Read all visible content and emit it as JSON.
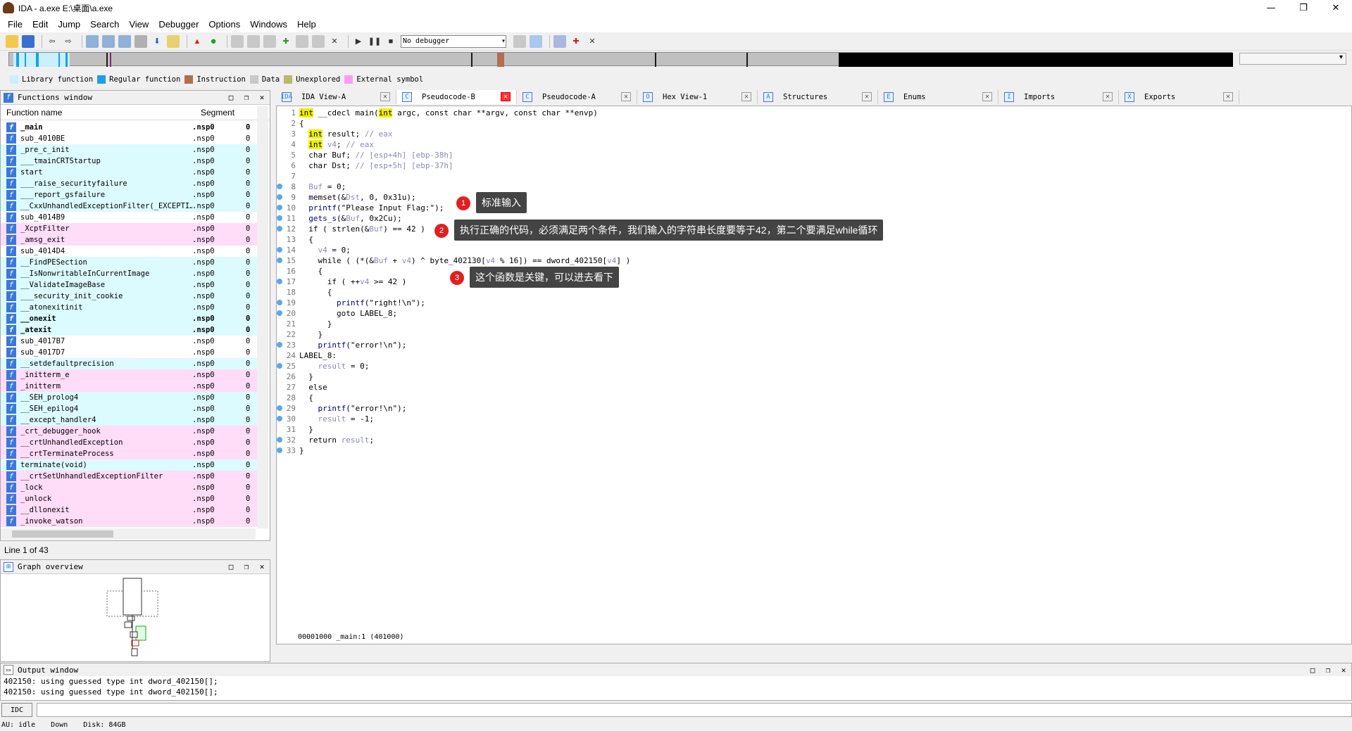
{
  "window": {
    "title": "IDA - a.exe E:\\桌面\\a.exe",
    "min": "—",
    "max": "❐",
    "close": "✕"
  },
  "menu": [
    "File",
    "Edit",
    "Jump",
    "Search",
    "View",
    "Debugger",
    "Options",
    "Windows",
    "Help"
  ],
  "toolbar": {
    "debugger_select": "No debugger"
  },
  "legend": [
    {
      "label": "Library function",
      "color": "#c8f0ff"
    },
    {
      "label": "Regular function",
      "color": "#1aa0e6"
    },
    {
      "label": "Instruction",
      "color": "#b07050"
    },
    {
      "label": "Data",
      "color": "#c8c8c8"
    },
    {
      "label": "Unexplored",
      "color": "#b8b870"
    },
    {
      "label": "External symbol",
      "color": "#ff9cf0"
    }
  ],
  "functions_window": {
    "title": "Functions window",
    "col_name": "Function name",
    "col_segment": "Segment",
    "col_s": "S",
    "line_info": "Line 1 of 43",
    "rows": [
      {
        "name": "_main",
        "seg": ".nsp0",
        "s": "0",
        "c": "white",
        "b": true
      },
      {
        "name": "sub_4010BE",
        "seg": ".nsp0",
        "s": "0",
        "c": "white",
        "b": false
      },
      {
        "name": "_pre_c_init",
        "seg": ".nsp0",
        "s": "0",
        "c": "cyan",
        "b": false
      },
      {
        "name": "___tmainCRTStartup",
        "seg": ".nsp0",
        "s": "0",
        "c": "cyan",
        "b": false
      },
      {
        "name": "start",
        "seg": ".nsp0",
        "s": "0",
        "c": "cyan",
        "b": false
      },
      {
        "name": "___raise_securityfailure",
        "seg": ".nsp0",
        "s": "0",
        "c": "cyan",
        "b": false
      },
      {
        "name": "___report_gsfailure",
        "seg": ".nsp0",
        "s": "0",
        "c": "cyan",
        "b": false
      },
      {
        "name": "__CxxUnhandledExceptionFilter(_EXCEPTI…",
        "seg": ".nsp0",
        "s": "0",
        "c": "cyan",
        "b": false
      },
      {
        "name": "sub_4014B9",
        "seg": ".nsp0",
        "s": "0",
        "c": "white",
        "b": false
      },
      {
        "name": "_XcptFilter",
        "seg": ".nsp0",
        "s": "0",
        "c": "pink",
        "b": false
      },
      {
        "name": "_amsg_exit",
        "seg": ".nsp0",
        "s": "0",
        "c": "pink",
        "b": false
      },
      {
        "name": "sub_4014D4",
        "seg": ".nsp0",
        "s": "0",
        "c": "white",
        "b": false
      },
      {
        "name": "__FindPESection",
        "seg": ".nsp0",
        "s": "0",
        "c": "cyan",
        "b": false
      },
      {
        "name": "__IsNonwritableInCurrentImage",
        "seg": ".nsp0",
        "s": "0",
        "c": "cyan",
        "b": false
      },
      {
        "name": "__ValidateImageBase",
        "seg": ".nsp0",
        "s": "0",
        "c": "cyan",
        "b": false
      },
      {
        "name": "___security_init_cookie",
        "seg": ".nsp0",
        "s": "0",
        "c": "cyan",
        "b": false
      },
      {
        "name": "__atonexitinit",
        "seg": ".nsp0",
        "s": "0",
        "c": "cyan",
        "b": false
      },
      {
        "name": "__onexit",
        "seg": ".nsp0",
        "s": "0",
        "c": "cyan",
        "b": true
      },
      {
        "name": "_atexit",
        "seg": ".nsp0",
        "s": "0",
        "c": "cyan",
        "b": true
      },
      {
        "name": "sub_4017B7",
        "seg": ".nsp0",
        "s": "0",
        "c": "white",
        "b": false
      },
      {
        "name": "sub_4017D7",
        "seg": ".nsp0",
        "s": "0",
        "c": "white",
        "b": false
      },
      {
        "name": "__setdefaultprecision",
        "seg": ".nsp0",
        "s": "0",
        "c": "cyan",
        "b": false
      },
      {
        "name": "_initterm_e",
        "seg": ".nsp0",
        "s": "0",
        "c": "pink",
        "b": false
      },
      {
        "name": "_initterm",
        "seg": ".nsp0",
        "s": "0",
        "c": "pink",
        "b": false
      },
      {
        "name": "__SEH_prolog4",
        "seg": ".nsp0",
        "s": "0",
        "c": "cyan",
        "b": false
      },
      {
        "name": "__SEH_epilog4",
        "seg": ".nsp0",
        "s": "0",
        "c": "cyan",
        "b": false
      },
      {
        "name": "__except_handler4",
        "seg": ".nsp0",
        "s": "0",
        "c": "cyan",
        "b": false
      },
      {
        "name": "_crt_debugger_hook",
        "seg": ".nsp0",
        "s": "0",
        "c": "pink",
        "b": false
      },
      {
        "name": "__crtUnhandledException",
        "seg": ".nsp0",
        "s": "0",
        "c": "pink",
        "b": false
      },
      {
        "name": "__crtTerminateProcess",
        "seg": ".nsp0",
        "s": "0",
        "c": "pink",
        "b": false
      },
      {
        "name": "terminate(void)",
        "seg": ".nsp0",
        "s": "0",
        "c": "cyan",
        "b": false
      },
      {
        "name": "__crtSetUnhandledExceptionFilter",
        "seg": ".nsp0",
        "s": "0",
        "c": "pink",
        "b": false
      },
      {
        "name": "_lock",
        "seg": ".nsp0",
        "s": "0",
        "c": "pink",
        "b": false
      },
      {
        "name": "_unlock",
        "seg": ".nsp0",
        "s": "0",
        "c": "pink",
        "b": false
      },
      {
        "name": "__dllonexit",
        "seg": ".nsp0",
        "s": "0",
        "c": "pink",
        "b": false
      },
      {
        "name": "_invoke_watson",
        "seg": ".nsp0",
        "s": "0",
        "c": "pink",
        "b": false
      }
    ]
  },
  "graph_overview": {
    "title": "Graph overview"
  },
  "tabs": [
    {
      "label": "IDA View-A",
      "icon": "IDA",
      "active": false
    },
    {
      "label": "Pseudocode-B",
      "icon": "C",
      "active": true
    },
    {
      "label": "Pseudocode-A",
      "icon": "C",
      "active": false
    },
    {
      "label": "Hex View-1",
      "icon": "O",
      "active": false
    },
    {
      "label": "Structures",
      "icon": "A",
      "active": false
    },
    {
      "label": "Enums",
      "icon": "E",
      "active": false
    },
    {
      "label": "Imports",
      "icon": "I",
      "active": false
    },
    {
      "label": "Exports",
      "icon": "X",
      "active": false
    }
  ],
  "code": {
    "status": "00001000 _main:1 (401000)",
    "lines": [
      {
        "n": "1",
        "dot": false,
        "h": "<span class='kw'>int</span> __cdecl main(<span class='kw'>int</span> argc, const char **argv, const char **envp)"
      },
      {
        "n": "2",
        "dot": false,
        "h": "{"
      },
      {
        "n": "3",
        "dot": false,
        "h": "  <span class='kw'>int</span> result; <span class='gray'>// eax</span>"
      },
      {
        "n": "4",
        "dot": false,
        "h": "  <span class='kw'>int</span> <span class='gray'>v4</span>; <span class='gray'>// eax</span>"
      },
      {
        "n": "5",
        "dot": false,
        "h": "  char Buf; <span class='gray'>// [esp+4h] [ebp-38h]</span>"
      },
      {
        "n": "6",
        "dot": false,
        "h": "  char Dst; <span class='gray'>// [esp+5h] [ebp-37h]</span>"
      },
      {
        "n": "7",
        "dot": false,
        "h": ""
      },
      {
        "n": "8",
        "dot": true,
        "h": "  <span class='gray'>Buf</span> = 0;"
      },
      {
        "n": "9",
        "dot": true,
        "h": "  memset(&amp;<span class='gray'>Dst</span>, 0, 0x31u);"
      },
      {
        "n": "10",
        "dot": true,
        "h": "  <span class='navy'>printf</span>(\"Please Input Flag:\");"
      },
      {
        "n": "11",
        "dot": true,
        "h": "  <span class='navy'>gets_s</span>(&amp;<span class='gray'>Buf</span>, 0x2Cu);"
      },
      {
        "n": "12",
        "dot": true,
        "h": "  if ( strlen(&amp;<span class='gray'>Buf</span>) == 42 )"
      },
      {
        "n": "13",
        "dot": false,
        "h": "  {"
      },
      {
        "n": "14",
        "dot": true,
        "h": "    <span class='gray'>v4</span> = 0;"
      },
      {
        "n": "15",
        "dot": true,
        "h": "    while ( (*(&amp;<span class='gray'>Buf</span> + <span class='gray'>v4</span>) ^ byte_402130[<span class='gray'>v4</span> % 16]) == dword_402150[<span class='gray'>v4</span>] )"
      },
      {
        "n": "16",
        "dot": false,
        "h": "    {"
      },
      {
        "n": "17",
        "dot": true,
        "h": "      if ( ++<span class='gray'>v4</span> &gt;= 42 )"
      },
      {
        "n": "18",
        "dot": false,
        "h": "      {"
      },
      {
        "n": "19",
        "dot": true,
        "h": "        <span class='navy'>printf</span>(\"right!\\n\");"
      },
      {
        "n": "20",
        "dot": true,
        "h": "        goto LABEL_8;"
      },
      {
        "n": "21",
        "dot": false,
        "h": "      }"
      },
      {
        "n": "22",
        "dot": false,
        "h": "    }"
      },
      {
        "n": "23",
        "dot": true,
        "h": "    <span class='navy'>printf</span>(\"error!\\n\");"
      },
      {
        "n": "24",
        "dot": false,
        "h": "LABEL_8:"
      },
      {
        "n": "25",
        "dot": true,
        "h": "    <span class='gray'>result</span> = 0;"
      },
      {
        "n": "26",
        "dot": false,
        "h": "  }"
      },
      {
        "n": "27",
        "dot": false,
        "h": "  else"
      },
      {
        "n": "28",
        "dot": false,
        "h": "  {"
      },
      {
        "n": "29",
        "dot": true,
        "h": "    <span class='navy'>printf</span>(\"error!\\n\");"
      },
      {
        "n": "30",
        "dot": true,
        "h": "    <span class='gray'>result</span> = -1;"
      },
      {
        "n": "31",
        "dot": false,
        "h": "  }"
      },
      {
        "n": "32",
        "dot": true,
        "h": "  return <span class='gray'>result</span>;"
      },
      {
        "n": "33",
        "dot": true,
        "h": "}"
      }
    ],
    "annotations": [
      {
        "num": "1",
        "text": "标准输入"
      },
      {
        "num": "2",
        "text": "执行正确的代码，必须满足两个条件，我们输入的字符串长度要等于42，第二个要满足while循环"
      },
      {
        "num": "3",
        "text": "这个函数是关键，可以进去看下"
      }
    ]
  },
  "output": {
    "title": "Output window",
    "lines": [
      "402150: using guessed type int dword_402150[];",
      "402150: using guessed type int dword_402150[];"
    ],
    "idc_label": "IDC"
  },
  "statusbar": {
    "au": "AU:  idle",
    "dir": "Down",
    "disk": "Disk: 84GB"
  }
}
